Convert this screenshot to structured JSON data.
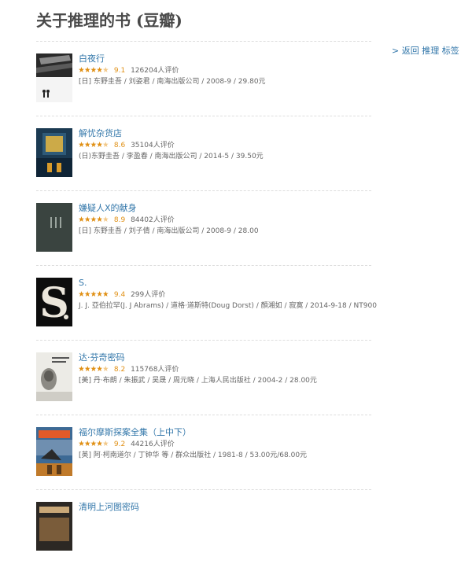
{
  "page": {
    "title": "关于推理的书 (豆瓣)"
  },
  "aside": {
    "back_link": "> 返回 推理 标签"
  },
  "books": [
    {
      "title": "白夜行",
      "rating": "9.1",
      "count": "126204人评价",
      "pub": "[日] 东野圭吾 / 刘姿君 / 南海出版公司 / 2008-9 / 29.80元",
      "stars_fraction": 0.9
    },
    {
      "title": "解忧杂货店",
      "rating": "8.6",
      "count": "35104人评价",
      "pub": "(日)东野圭吾 / 李盈春 / 南海出版公司 / 2014-5 / 39.50元",
      "stars_fraction": 0.9
    },
    {
      "title": "嫌疑人X的献身",
      "rating": "8.9",
      "count": "84402人评价",
      "pub": "[日] 东野圭吾 / 刘子倩 / 南海出版公司 / 2008-9 / 28.00",
      "stars_fraction": 0.9
    },
    {
      "title": "S.",
      "rating": "9.4",
      "count": "299人评价",
      "pub": "J. J. 亞伯拉罕(J. J Abrams) / 道格·道斯特(Doug Dorst) / 顏湘如 / 寂寞 / 2014-9-18 / NT900",
      "stars_fraction": 1.0
    },
    {
      "title": "达·芬奇密码",
      "rating": "8.2",
      "count": "115768人评价",
      "pub": "[美] 丹·布朗 / 朱振武 / 吴晟 / 周元晓 / 上海人民出版社 / 2004-2 / 28.00元",
      "stars_fraction": 0.9
    },
    {
      "title": "福尔摩斯探案全集（上中下）",
      "rating": "9.2",
      "count": "44216人评价",
      "pub": "[英] 阿·柯南道尔 / 丁钟华 等 / 群众出版社 / 1981-8 / 53.00元/68.00元",
      "stars_fraction": 0.9
    },
    {
      "title": "清明上河图密码",
      "rating": "",
      "count": "",
      "pub": "",
      "stars_fraction": 0
    }
  ],
  "colors": {
    "link": "#3377aa",
    "star": "#e09015",
    "meta": "#666666",
    "title": "#494949"
  }
}
